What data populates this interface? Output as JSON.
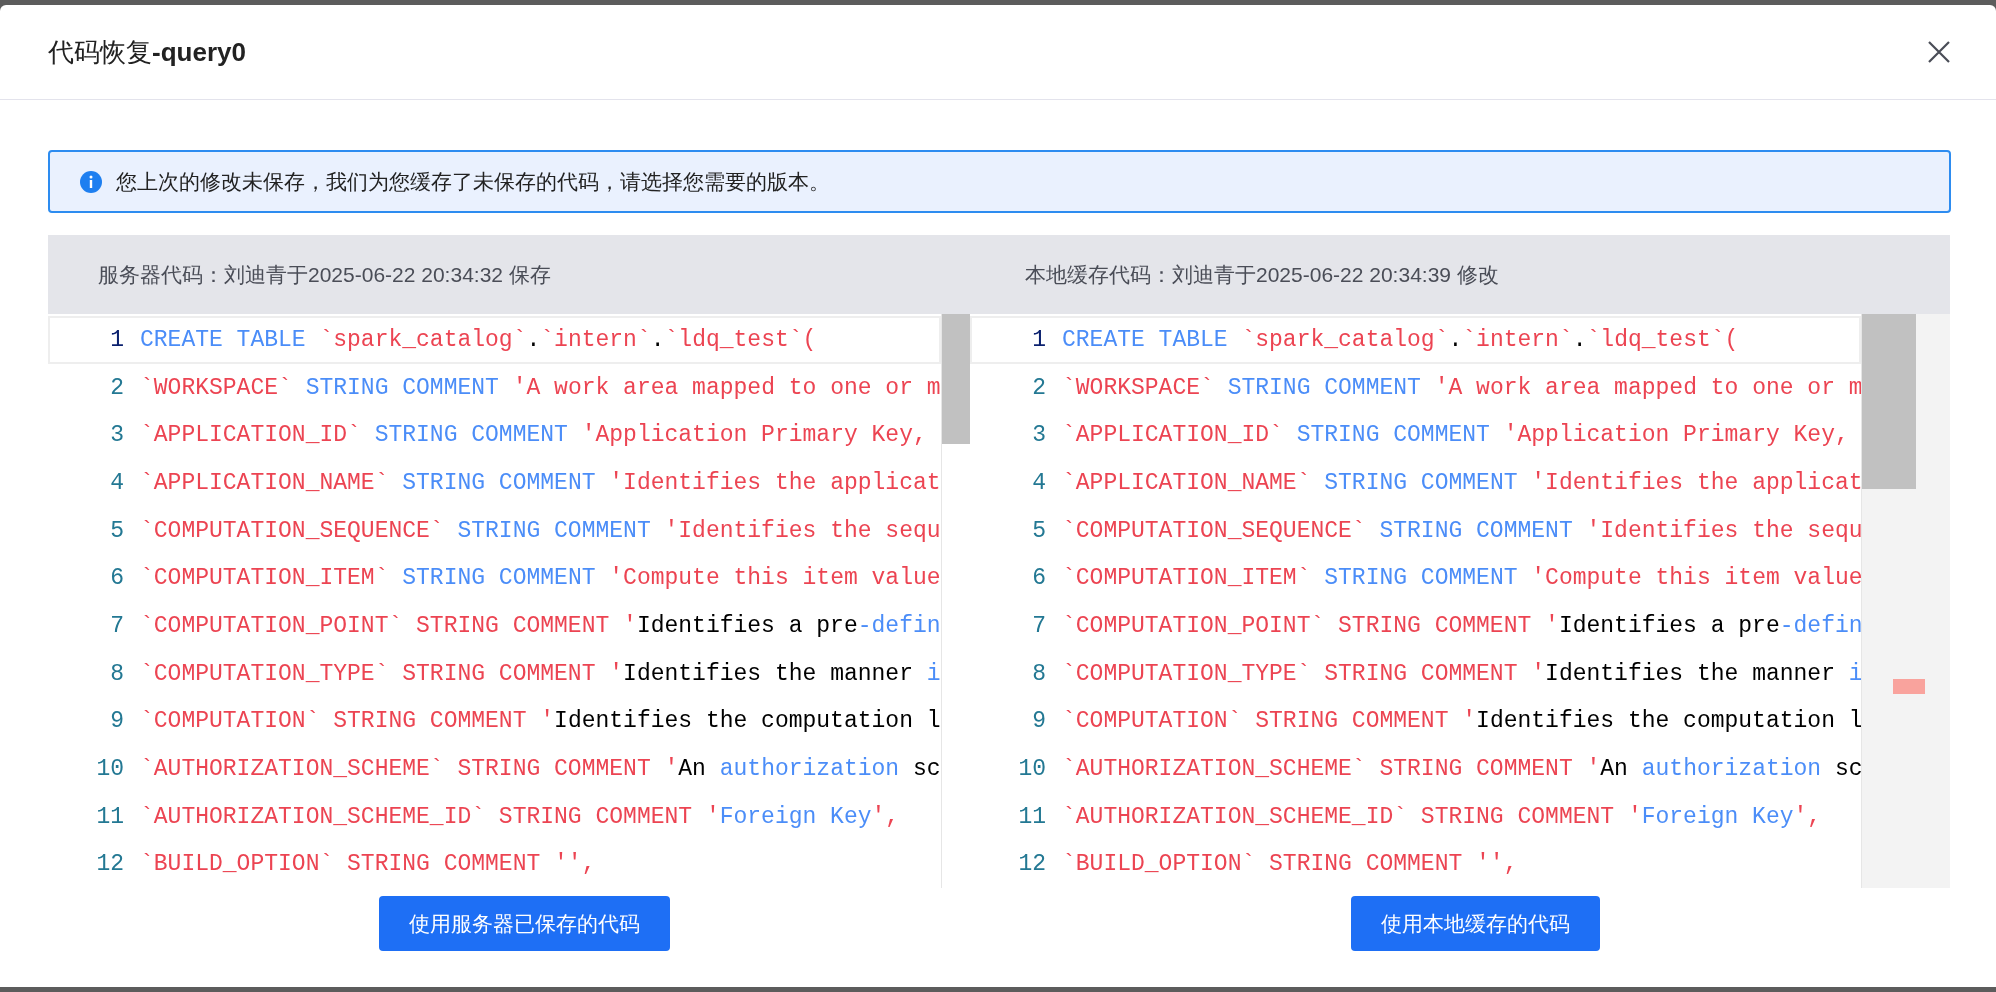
{
  "dialog": {
    "title": "代码恢复**-query0**"
  },
  "notice": {
    "text": "您上次的修改未保存，我们为您缓存了未保存的代码，请选择您需要的版本。"
  },
  "panes": [
    {
      "caption": "服务器代码：刘迪青于2025-06-22 20:34:32 保存",
      "change_ruler": false,
      "button": "使用服务器已保存的代码",
      "lines": [
        {
          "number": "1",
          "current": true,
          "tokens": [
            {
              "kind": "kw",
              "text": "CREATE TABLE "
            },
            {
              "kind": "str",
              "text": "`spark_catalog`"
            },
            {
              "kind": "plain",
              "text": "."
            },
            {
              "kind": "str",
              "text": "`intern`"
            },
            {
              "kind": "plain",
              "text": "."
            },
            {
              "kind": "str",
              "text": "`ldq_test`("
            }
          ]
        },
        {
          "number": "2",
          "current": false,
          "tokens": [
            {
              "kind": "str",
              "text": "`WORKSPACE` "
            },
            {
              "kind": "kw",
              "text": "STRING COMMENT "
            },
            {
              "kind": "str",
              "text": "'A work area mapped to one or m"
            }
          ]
        },
        {
          "number": "3",
          "current": false,
          "tokens": [
            {
              "kind": "str",
              "text": "`APPLICATION_ID` "
            },
            {
              "kind": "kw",
              "text": "STRING COMMENT "
            },
            {
              "kind": "str",
              "text": "'Application Primary Key,"
            }
          ]
        },
        {
          "number": "4",
          "current": false,
          "tokens": [
            {
              "kind": "str",
              "text": "`APPLICATION_NAME` "
            },
            {
              "kind": "kw",
              "text": "STRING COMMENT "
            },
            {
              "kind": "str",
              "text": "'Identifies the applicat"
            }
          ]
        },
        {
          "number": "5",
          "current": false,
          "tokens": [
            {
              "kind": "str",
              "text": "`COMPUTATION_SEQUENCE` "
            },
            {
              "kind": "kw",
              "text": "STRING COMMENT "
            },
            {
              "kind": "str",
              "text": "'Identifies the sequ"
            }
          ]
        },
        {
          "number": "6",
          "current": false,
          "tokens": [
            {
              "kind": "str",
              "text": "`COMPUTATION_ITEM` "
            },
            {
              "kind": "kw",
              "text": "STRING COMMENT "
            },
            {
              "kind": "str",
              "text": "'Compute this item value"
            }
          ]
        },
        {
          "number": "7",
          "current": false,
          "tokens": [
            {
              "kind": "str",
              "text": "`COMPUTATION_POINT` STRING COMMENT '"
            },
            {
              "kind": "plain",
              "text": "Identifies a pre"
            },
            {
              "kind": "kw",
              "text": "-defin"
            }
          ]
        },
        {
          "number": "8",
          "current": false,
          "tokens": [
            {
              "kind": "str",
              "text": "`COMPUTATION_TYPE` STRING COMMENT '"
            },
            {
              "kind": "plain",
              "text": "Identifies the manner "
            },
            {
              "kind": "kw",
              "text": "i"
            }
          ]
        },
        {
          "number": "9",
          "current": false,
          "tokens": [
            {
              "kind": "str",
              "text": "`COMPUTATION` STRING COMMENT '"
            },
            {
              "kind": "plain",
              "text": "Identifies the computation l"
            }
          ]
        },
        {
          "number": "10",
          "current": false,
          "tokens": [
            {
              "kind": "str",
              "text": "`AUTHORIZATION_SCHEME` STRING COMMENT '"
            },
            {
              "kind": "plain",
              "text": "An "
            },
            {
              "kind": "kw",
              "text": "authorization"
            },
            {
              "kind": "plain",
              "text": " sc"
            }
          ]
        },
        {
          "number": "11",
          "current": false,
          "tokens": [
            {
              "kind": "str",
              "text": "`AUTHORIZATION_SCHEME_ID` STRING COMMENT '"
            },
            {
              "kind": "kw",
              "text": "Foreign Key"
            },
            {
              "kind": "str",
              "text": "',"
            }
          ]
        },
        {
          "number": "12",
          "current": false,
          "tokens": [
            {
              "kind": "str",
              "text": "`BUILD_OPTION` STRING COMMENT '',"
            }
          ]
        }
      ]
    },
    {
      "caption": "本地缓存代码：刘迪青于2025-06-22 20:34:39 修改",
      "change_ruler": true,
      "button": "使用本地缓存的代码",
      "lines": [
        {
          "number": "1",
          "current": true,
          "tokens": [
            {
              "kind": "kw",
              "text": "CREATE TABLE "
            },
            {
              "kind": "str",
              "text": "`spark_catalog`"
            },
            {
              "kind": "plain",
              "text": "."
            },
            {
              "kind": "str",
              "text": "`intern`"
            },
            {
              "kind": "plain",
              "text": "."
            },
            {
              "kind": "str",
              "text": "`ldq_test`("
            }
          ]
        },
        {
          "number": "2",
          "current": false,
          "tokens": [
            {
              "kind": "str",
              "text": "`WORKSPACE` "
            },
            {
              "kind": "kw",
              "text": "STRING COMMENT "
            },
            {
              "kind": "str",
              "text": "'A work area mapped to one or m"
            }
          ]
        },
        {
          "number": "3",
          "current": false,
          "tokens": [
            {
              "kind": "str",
              "text": "`APPLICATION_ID` "
            },
            {
              "kind": "kw",
              "text": "STRING COMMENT "
            },
            {
              "kind": "str",
              "text": "'Application Primary Key,"
            }
          ]
        },
        {
          "number": "4",
          "current": false,
          "tokens": [
            {
              "kind": "str",
              "text": "`APPLICATION_NAME` "
            },
            {
              "kind": "kw",
              "text": "STRING COMMENT "
            },
            {
              "kind": "str",
              "text": "'Identifies the applicat"
            }
          ]
        },
        {
          "number": "5",
          "current": false,
          "tokens": [
            {
              "kind": "str",
              "text": "`COMPUTATION_SEQUENCE` "
            },
            {
              "kind": "kw",
              "text": "STRING COMMENT "
            },
            {
              "kind": "str",
              "text": "'Identifies the sequ"
            }
          ]
        },
        {
          "number": "6",
          "current": false,
          "tokens": [
            {
              "kind": "str",
              "text": "`COMPUTATION_ITEM` "
            },
            {
              "kind": "kw",
              "text": "STRING COMMENT "
            },
            {
              "kind": "str",
              "text": "'Compute this item value"
            }
          ]
        },
        {
          "number": "7",
          "current": false,
          "tokens": [
            {
              "kind": "str",
              "text": "`COMPUTATION_POINT` STRING COMMENT '"
            },
            {
              "kind": "plain",
              "text": "Identifies a pre"
            },
            {
              "kind": "kw",
              "text": "-defin"
            }
          ]
        },
        {
          "number": "8",
          "current": false,
          "tokens": [
            {
              "kind": "str",
              "text": "`COMPUTATION_TYPE` STRING COMMENT '"
            },
            {
              "kind": "plain",
              "text": "Identifies the manner "
            },
            {
              "kind": "kw",
              "text": "i"
            }
          ]
        },
        {
          "number": "9",
          "current": false,
          "tokens": [
            {
              "kind": "str",
              "text": "`COMPUTATION` STRING COMMENT '"
            },
            {
              "kind": "plain",
              "text": "Identifies the computation l"
            }
          ]
        },
        {
          "number": "10",
          "current": false,
          "tokens": [
            {
              "kind": "str",
              "text": "`AUTHORIZATION_SCHEME` STRING COMMENT '"
            },
            {
              "kind": "plain",
              "text": "An "
            },
            {
              "kind": "kw",
              "text": "authorization"
            },
            {
              "kind": "plain",
              "text": " sc"
            }
          ]
        },
        {
          "number": "11",
          "current": false,
          "tokens": [
            {
              "kind": "str",
              "text": "`AUTHORIZATION_SCHEME_ID` STRING COMMENT '"
            },
            {
              "kind": "kw",
              "text": "Foreign Key"
            },
            {
              "kind": "str",
              "text": "',"
            }
          ]
        },
        {
          "number": "12",
          "current": false,
          "tokens": [
            {
              "kind": "str",
              "text": "`BUILD_OPTION` STRING COMMENT '',"
            }
          ]
        }
      ]
    }
  ]
}
